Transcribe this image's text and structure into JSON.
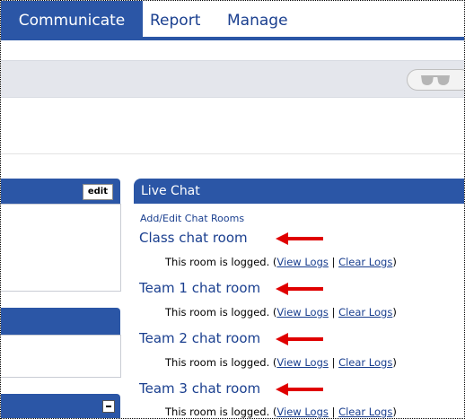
{
  "nav": {
    "tabs": [
      {
        "label": "Communicate",
        "active": true
      },
      {
        "label": "Report",
        "active": false
      },
      {
        "label": "Manage",
        "active": false
      }
    ]
  },
  "toolbar": {
    "icon": "sunglasses-icon"
  },
  "left_panels": [
    {
      "button": "edit"
    },
    {
      "button": ""
    },
    {
      "button": "minus"
    }
  ],
  "live_chat": {
    "title": "Live Chat",
    "add_edit_link": "Add/Edit Chat Rooms",
    "rooms": [
      {
        "name": "Class chat room",
        "status": "This room is logged. (",
        "view_logs": "View Logs",
        "separator": " | ",
        "clear_logs": "Clear Logs",
        "close": ")"
      },
      {
        "name": "Team 1 chat room",
        "status": "This room is logged. (",
        "view_logs": "View Logs",
        "separator": " | ",
        "clear_logs": "Clear Logs",
        "close": ")"
      },
      {
        "name": "Team 2 chat room",
        "status": "This room is logged. (",
        "view_logs": "View Logs",
        "separator": " | ",
        "clear_logs": "Clear Logs",
        "close": ")"
      },
      {
        "name": "Team 3 chat room",
        "status": "This room is logged. (",
        "view_logs": "View Logs",
        "separator": " | ",
        "clear_logs": "Clear Logs",
        "close": ")"
      }
    ]
  },
  "colors": {
    "nav_blue": "#2b56a6",
    "link_blue": "#1a3f8f",
    "annotation_arrow": "#e00000"
  }
}
